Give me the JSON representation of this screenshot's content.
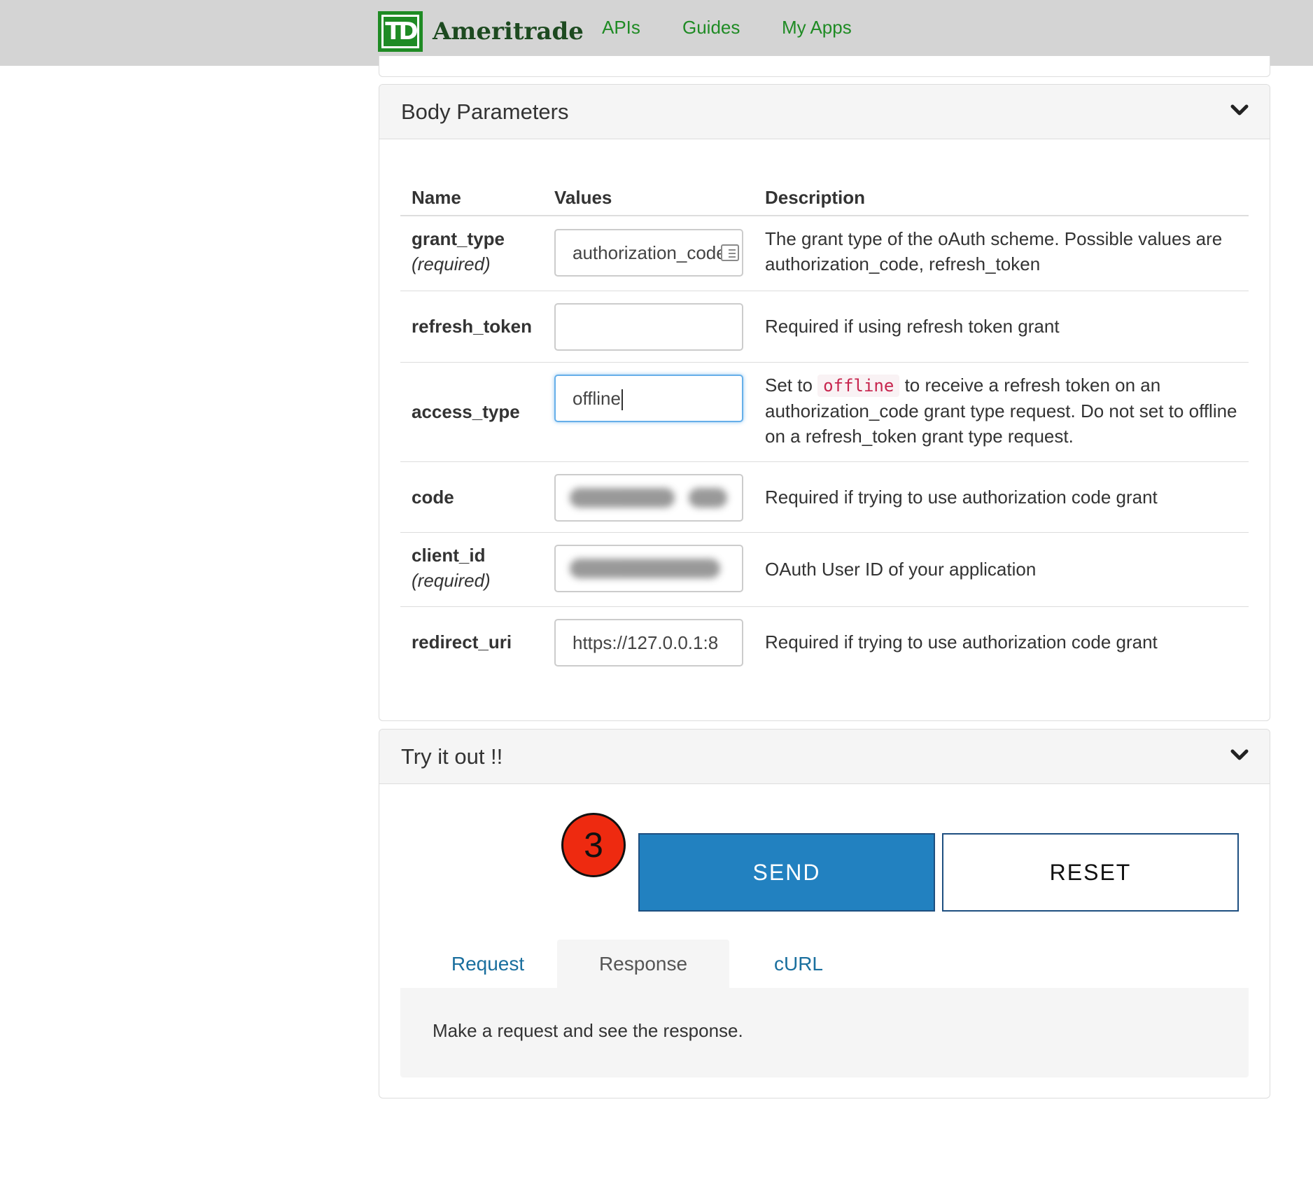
{
  "header": {
    "logo_mark": "TD",
    "logo_text": "Ameritrade",
    "nav": [
      "APIs",
      "Guides",
      "My Apps"
    ]
  },
  "body_parameters": {
    "title": "Body Parameters",
    "columns": [
      "Name",
      "Values",
      "Description"
    ],
    "rows": [
      {
        "name": "grant_type",
        "required": "(required)",
        "value": "authorization_code",
        "description": "The grant type of the oAuth scheme. Possible values are authorization_code, refresh_token"
      },
      {
        "name": "refresh_token",
        "required": "",
        "value": "",
        "description": "Required if using refresh token grant"
      },
      {
        "name": "access_type",
        "required": "",
        "value": "offline",
        "description_prefix": "Set to",
        "description_code": "offline",
        "description_suffix": "to receive a refresh token on an authorization_code grant type request. Do not set to offline on a refresh_token grant type request."
      },
      {
        "name": "code",
        "required": "",
        "value": "",
        "description": "Required if trying to use authorization code grant"
      },
      {
        "name": "client_id",
        "required": "(required)",
        "value": "",
        "description": "OAuth User ID of your application"
      },
      {
        "name": "redirect_uri",
        "required": "",
        "value": "https://127.0.0.1:8",
        "description": "Required if trying to use authorization code grant"
      }
    ]
  },
  "try_it_out": {
    "title": "Try it out !!",
    "step_badge": "3",
    "send_label": "SEND",
    "reset_label": "RESET",
    "tabs": [
      "Request",
      "Response",
      "cURL"
    ],
    "active_tab": "Response",
    "response_placeholder": "Make a request and see the response."
  },
  "colors": {
    "brand_green": "#1f8b24",
    "send_blue": "#2281c0",
    "badge_red": "#ee2a10",
    "code_red": "#c7254e"
  }
}
